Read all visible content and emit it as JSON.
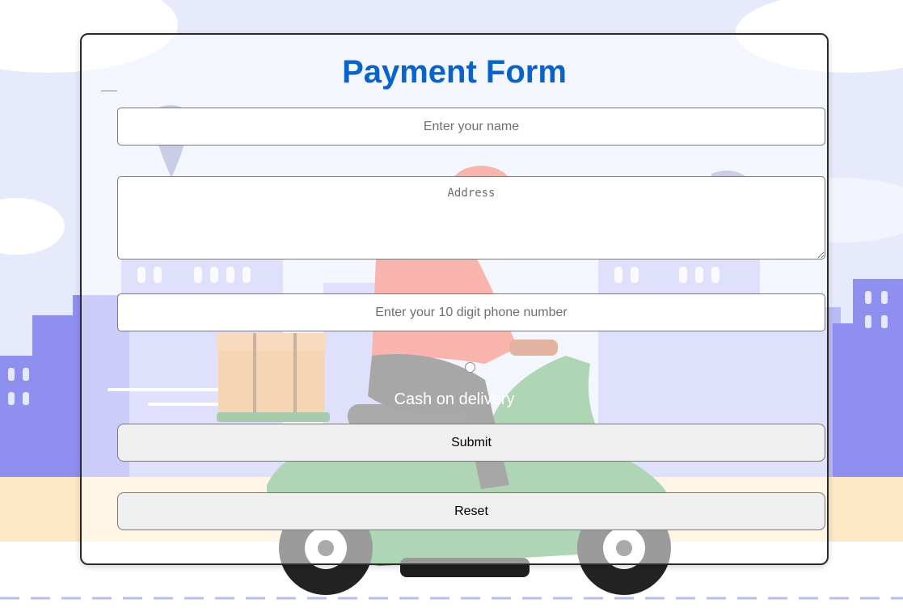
{
  "form": {
    "title": "Payment Form",
    "name_placeholder": "Enter your name",
    "address_placeholder": "Address",
    "phone_placeholder": "Enter your 10 digit phone number",
    "payment_option_label": "Cash on delivery",
    "submit_label": "Submit",
    "reset_label": "Reset"
  },
  "colors": {
    "title": "#0a63c9",
    "sky": "#dfe4fb",
    "buildings": "#8f8ff0",
    "scooter": "#4fa55a",
    "rider_shirt": "#f05a4a",
    "box": "#e9a25a",
    "ground": "#fde9c6"
  },
  "background": {
    "illustration": "delivery-scooter-city-illustration"
  }
}
